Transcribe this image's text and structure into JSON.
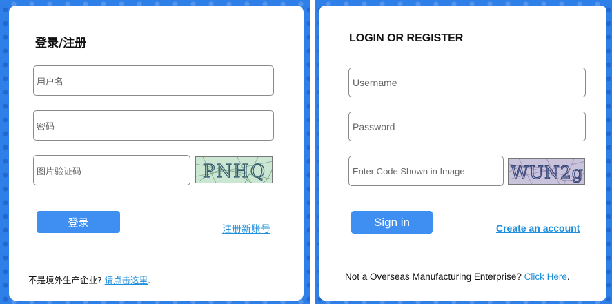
{
  "left_panel": {
    "title": "登录/注册",
    "username_placeholder": "用户名",
    "password_placeholder": "密码",
    "captcha_placeholder": "图片验证码",
    "captcha_text": "PNHQ",
    "login_button": "登录",
    "create_account_link": "注册新账号",
    "footer_text": "不是境外生产企业?",
    "footer_link": "请点击这里",
    "footer_end": "."
  },
  "right_panel": {
    "title": "LOGIN OR REGISTER",
    "username_placeholder": "Username",
    "password_placeholder": "Password",
    "captcha_placeholder": "Enter Code Shown in Image",
    "captcha_text": "WUN2g",
    "login_button": "Sign in",
    "create_account_link": "Create an account",
    "footer_text": "Not a Overseas Manufacturing Enterprise?",
    "footer_link": "Click Here",
    "footer_end": "."
  },
  "colors": {
    "background_blue": "#2f7fe8",
    "button_blue": "#3f8ff3",
    "link_blue": "#1e8fdc"
  }
}
